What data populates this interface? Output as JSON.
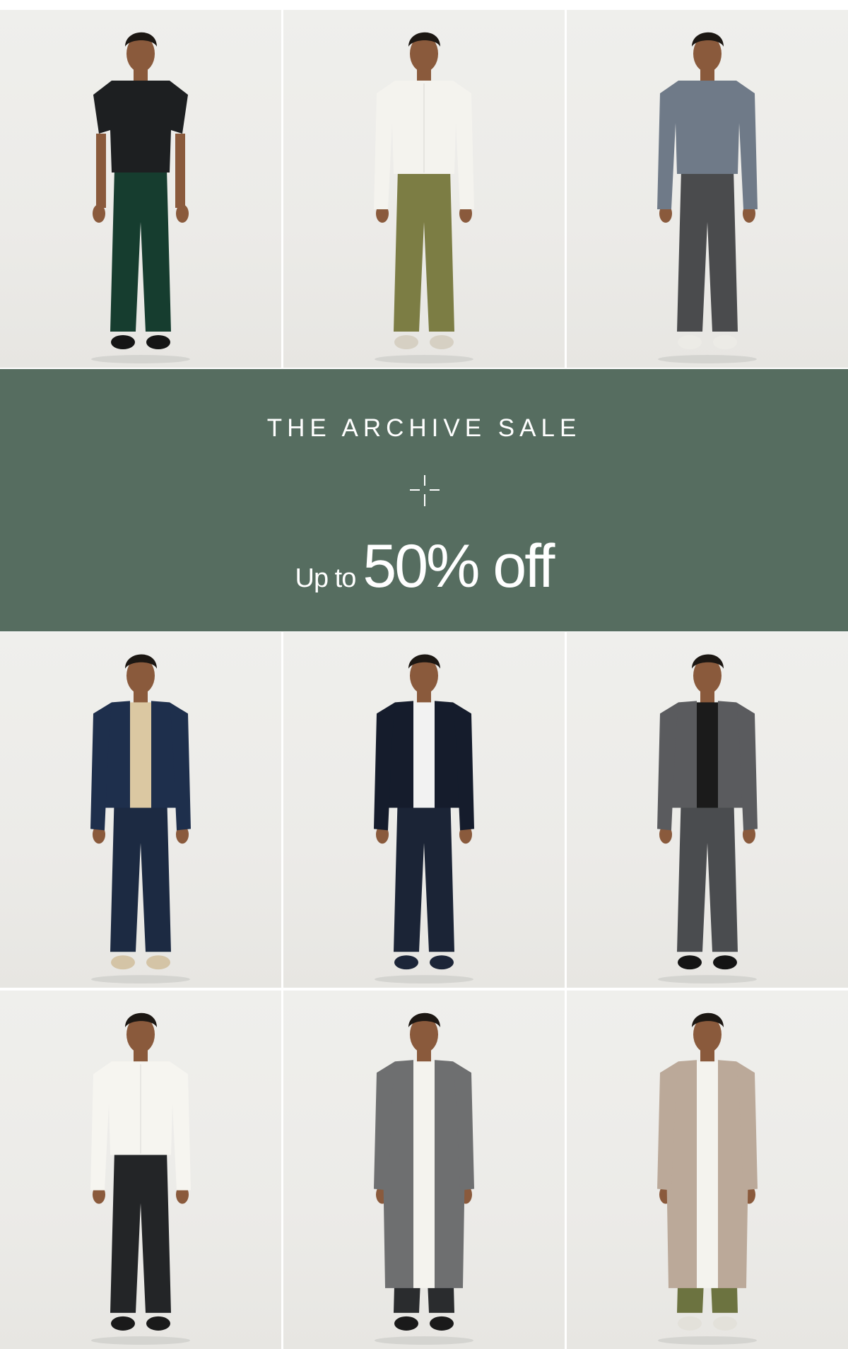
{
  "banner": {
    "title": "THE ARCHIVE SALE",
    "offer_prefix": "Up to",
    "offer_main": "50% off",
    "background_color": "#566d60",
    "text_color": "#ffffff",
    "mark_icon": "sparkle-cross-icon"
  },
  "products": [
    {
      "id": "p1",
      "top": "#1d1f21",
      "top_style": "tshirt",
      "pants": "#163d2f",
      "shoes": "#151515",
      "jacket": null
    },
    {
      "id": "p2",
      "top": "#f4f3ee",
      "top_style": "shirt",
      "pants": "#7c7d44",
      "shoes": "#d6d0c3",
      "jacket": null
    },
    {
      "id": "p3",
      "top": "#6f7a88",
      "top_style": "sweater",
      "pants": "#4a4b4d",
      "shoes": "#ecebe6",
      "jacket": null
    },
    {
      "id": "p4",
      "top": "#dbc8a2",
      "top_style": "tee",
      "pants": "#1c2a42",
      "shoes": "#d4c4a6",
      "jacket": "#1e2f4c",
      "jacket_style": "bomber"
    },
    {
      "id": "p5",
      "top": "#f2f2f2",
      "top_style": "tee",
      "pants": "#1b2436",
      "shoes": "#1c2538",
      "jacket": "#151c2c",
      "jacket_style": "bomber"
    },
    {
      "id": "p6",
      "top": "#1b1b1b",
      "top_style": "tee",
      "pants": "#4a4c4f",
      "shoes": "#141414",
      "jacket": "#5a5b5e",
      "jacket_style": "bomber"
    },
    {
      "id": "p7",
      "top": "#f6f5f0",
      "top_style": "shirt",
      "pants": "#232527",
      "shoes": "#1a1a1a",
      "jacket": null
    },
    {
      "id": "p8",
      "top": "#f4f3ee",
      "top_style": "shirt",
      "pants": "#2a2c2e",
      "shoes": "#1a1a1a",
      "jacket": "#6e6f70",
      "jacket_style": "coat"
    },
    {
      "id": "p9",
      "top": "#f4f3ee",
      "top_style": "shirt",
      "pants": "#6c7340",
      "shoes": "#e3e1da",
      "jacket": "#bba999",
      "jacket_style": "coat"
    }
  ]
}
